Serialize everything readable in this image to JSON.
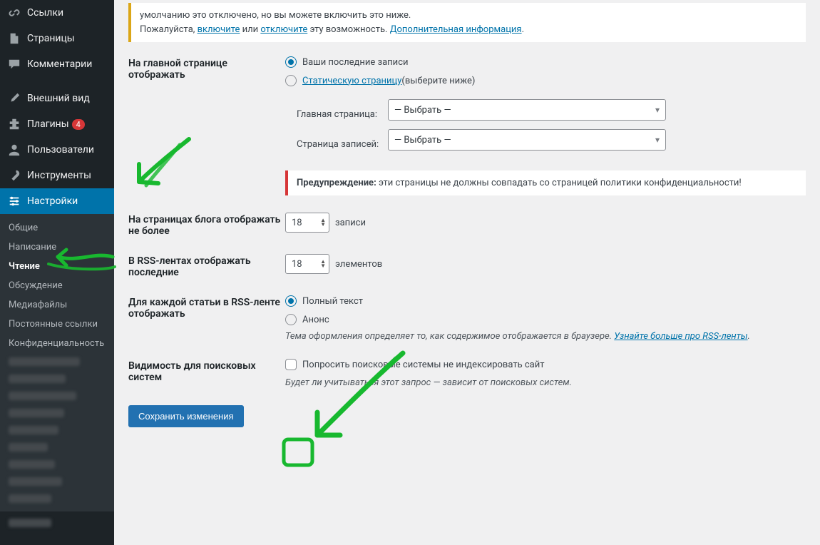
{
  "sidebar": {
    "items": [
      {
        "label": "Ссылки"
      },
      {
        "label": "Страницы"
      },
      {
        "label": "Комментарии"
      },
      {
        "label": "Внешний вид"
      },
      {
        "label": "Плагины",
        "badge": "4"
      },
      {
        "label": "Пользователи"
      },
      {
        "label": "Инструменты"
      },
      {
        "label": "Настройки"
      }
    ],
    "submenu": [
      "Общие",
      "Написание",
      "Чтение",
      "Обсуждение",
      "Медиафайлы",
      "Постоянные ссылки",
      "Конфиденциальность"
    ]
  },
  "notice": {
    "line1a": "умолчанию это отключено, но вы можете включить это ниже.",
    "line2a": "Пожалуйста, ",
    "enable": "включите",
    "or": " или ",
    "disable": "отключите",
    "line2b": " эту возможность. ",
    "more": "Дополнительная информация",
    "dot": "."
  },
  "form": {
    "frontpage_label": "На главной странице отображать",
    "latest_posts": "Ваши последние записи",
    "static_link": "Статическую страницу",
    "static_hint": " (выберите ниже)",
    "front_label": "Главная страница:",
    "posts_label": "Страница записей:",
    "select_placeholder": "— Выбрать —",
    "warning_strong": "Предупреждение:",
    "warning_text": " эти страницы не должны совпадать со страницей политики конфиденциальности!",
    "blog_pages_label": "На страницах блога отображать не более",
    "posts_unit": "записи",
    "rss_items_label": "В RSS-лентах отображать последние",
    "rss_unit": "элементов",
    "number_value": "18",
    "feed_label": "Для каждой статьи в RSS-ленте отображать",
    "full_text": "Полный текст",
    "summary": "Анонс",
    "feed_desc_a": "Тема оформления определяет то, как содержимое отображается в браузере. ",
    "feed_desc_link": "Узнайте больше про RSS-ленты",
    "feed_desc_b": ".",
    "visibility_label": "Видимость для поисковых систем",
    "discourage": "Попросить поисковые системы не индексировать сайт",
    "visibility_hint": "Будет ли учитываться этот запрос — зависит от поисковых систем.",
    "save": "Сохранить изменения"
  }
}
